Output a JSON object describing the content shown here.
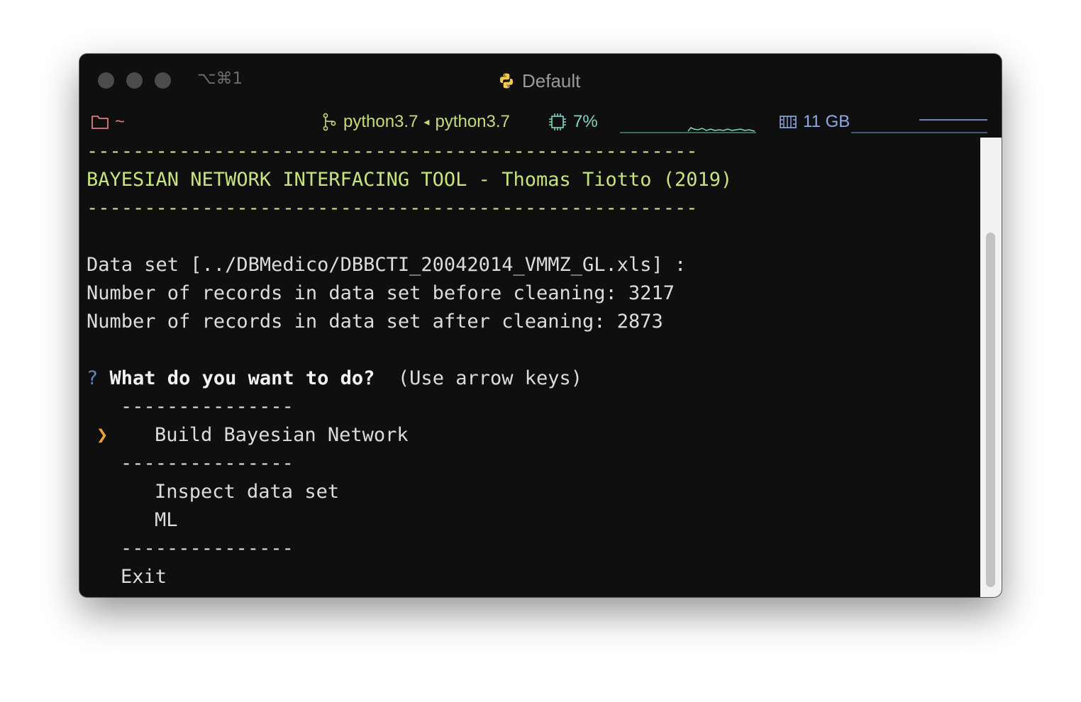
{
  "window": {
    "shortcut": "⌥⌘1",
    "title": "Default"
  },
  "statusbar": {
    "folder_path": "~",
    "branch_text": "python3.7",
    "branch_arrow": "◂",
    "branch_upstream": "python3.7",
    "cpu_text": "7%",
    "memory_text": "11 GB",
    "colors": {
      "folder": "#e07f7a",
      "branch": "#c4dc74",
      "cpu": "#7fd6c1",
      "memory": "#8fa9e6"
    },
    "icons": [
      "folder-icon",
      "git-branch-icon",
      "cpu-chip-icon",
      "memory-icon",
      "python-logo-icon"
    ]
  },
  "terminal": {
    "rule_top": "-----------------------------------------------------",
    "banner": "BAYESIAN NETWORK INTERFACING TOOL - Thomas Tiotto (2019)",
    "rule_bottom": "-----------------------------------------------------",
    "dataset_line": "Data set [../DBMedico/DBBCTI_20042014_VMMZ_GL.xls] :",
    "records_before": "Number of records in data set before cleaning: 3217",
    "records_after": "Number of records in data set after cleaning: 2873",
    "prompt_mark": "?",
    "prompt_question": "What do you want to do?",
    "prompt_hint": "(Use arrow keys)",
    "separator": "---------------",
    "pointer": "❯",
    "menu": [
      "Build Bayesian Network",
      "Inspect data set",
      "ML",
      "Exit"
    ],
    "selected_index": 0
  }
}
